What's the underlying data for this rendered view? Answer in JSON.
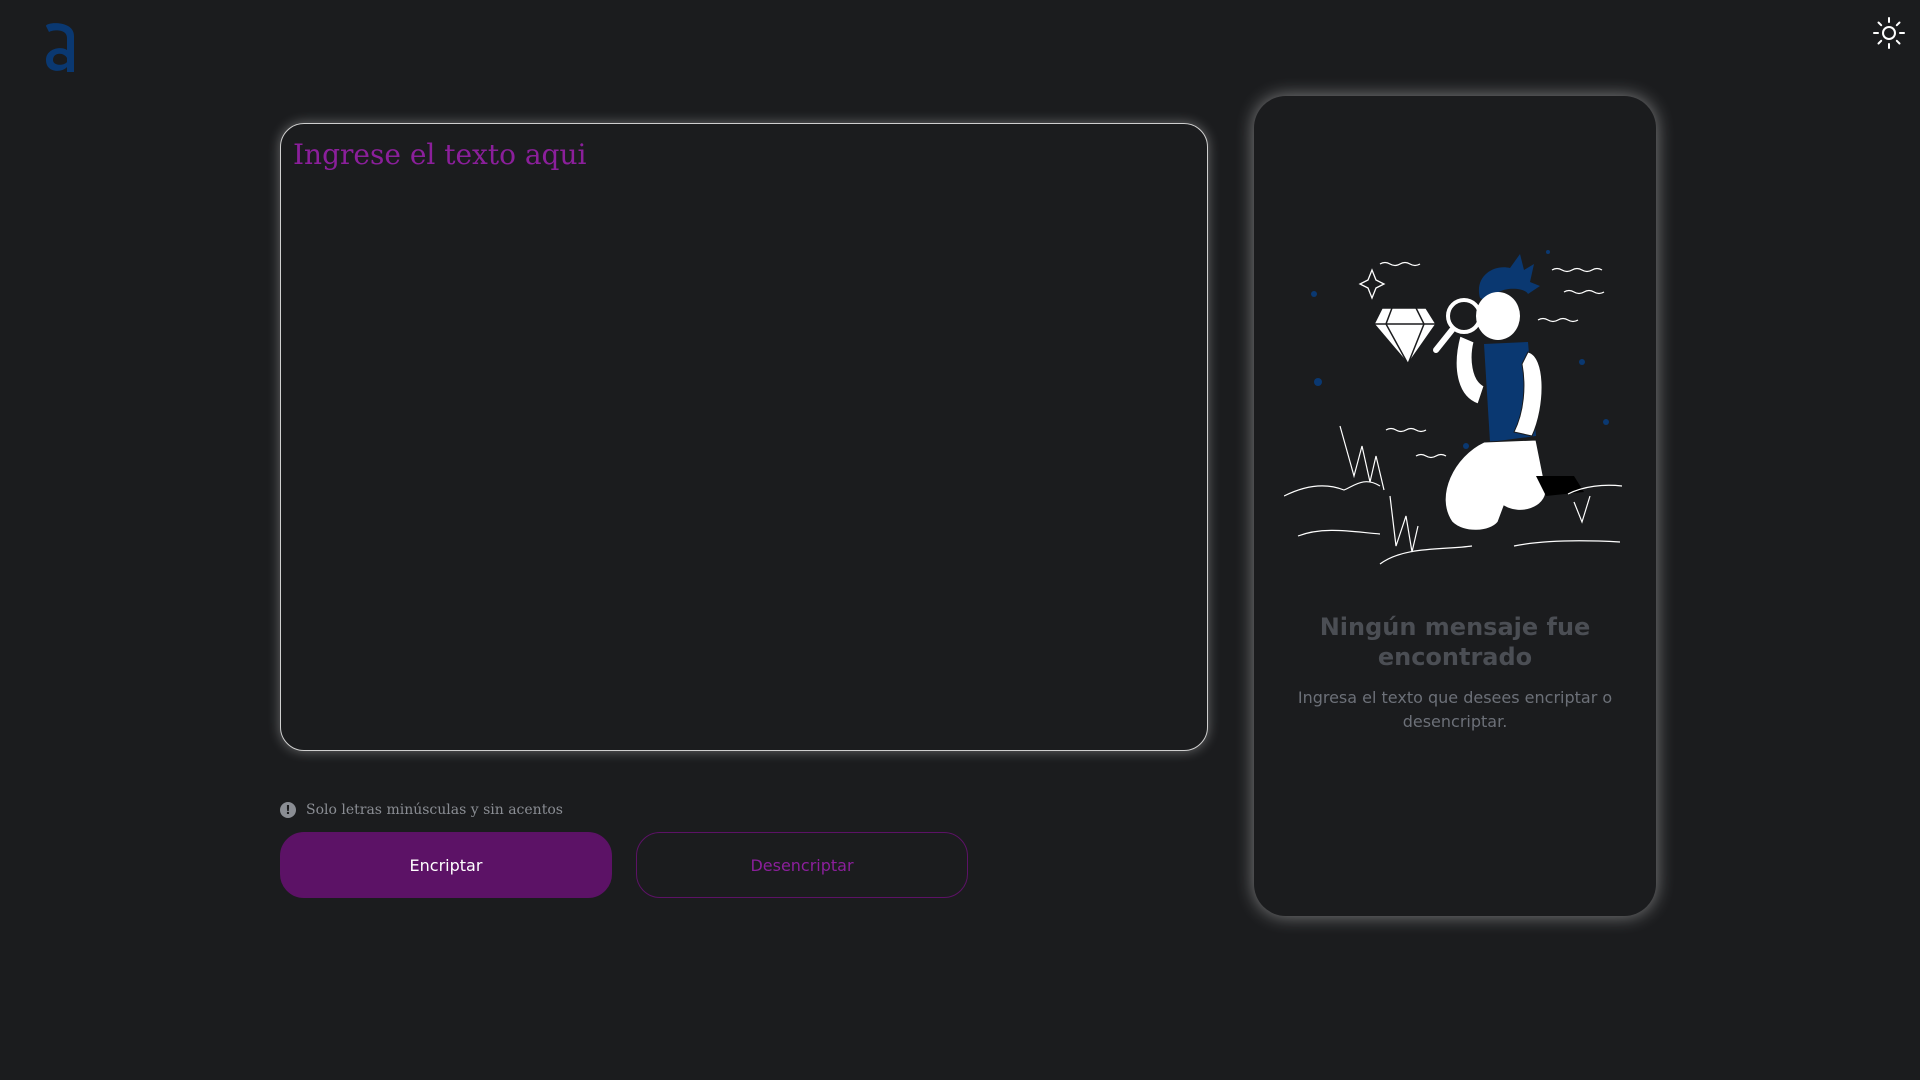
{
  "header": {
    "logo_icon": "alura-logo-icon",
    "theme_toggle_icon": "sun-icon"
  },
  "editor": {
    "placeholder": "Ingrese el texto aqui"
  },
  "hint": {
    "icon": "info-icon",
    "text": "Solo letras minúsculas y sin acentos"
  },
  "actions": {
    "encrypt_label": "Encriptar",
    "decrypt_label": "Desencriptar"
  },
  "output": {
    "illustration": "person-with-magnifier-illustration",
    "empty_title": "Ningún mensaje fue encontrado",
    "empty_description": "Ingresa el texto que desees encriptar o desencriptar."
  },
  "colors": {
    "background": "#1b1c1e",
    "accent": "#5c1266",
    "accent_text": "#8b1f9b",
    "logo": "#0a3871"
  }
}
